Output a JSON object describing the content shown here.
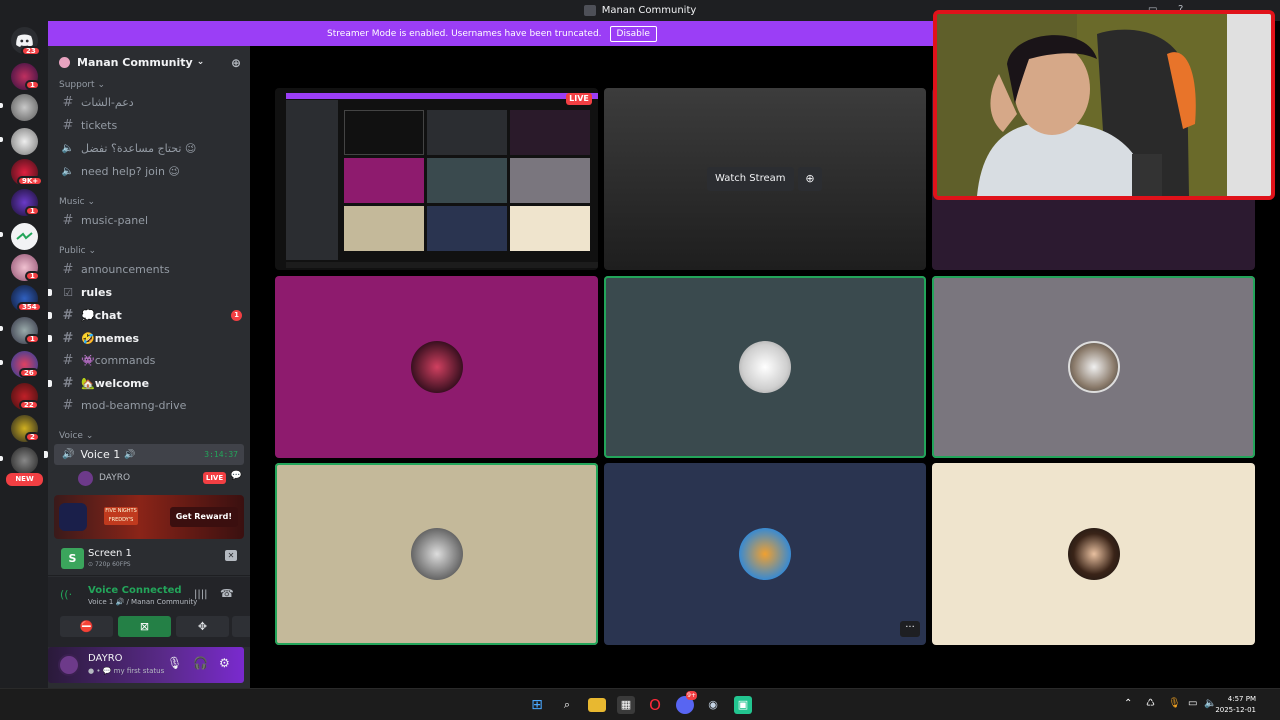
{
  "window": {
    "title": "Manan Community"
  },
  "banner": {
    "text": "Streamer Mode is enabled. Usernames have been truncated.",
    "button": "Disable"
  },
  "guild_badges": {
    "home": "23",
    "b1": "1",
    "b2": "9K+",
    "b3": "1",
    "b4": "1",
    "b5": "354",
    "b6": "1",
    "b7": "26",
    "b8": "22",
    "b9": "2",
    "new": "NEW"
  },
  "server": {
    "name": "Manan Community",
    "chevron": "⌄"
  },
  "categories": {
    "support": "Support",
    "music": "Music",
    "public": "Public",
    "voice": "Voice"
  },
  "channels": {
    "support_ar": "دعم-الشات",
    "tickets": "tickets",
    "need_help_ar": "تحتاج مساعدة؟ تفضل 😉",
    "need_help_en": "need help? join 😉",
    "music_panel": "music-panel",
    "announcements": "announcements",
    "rules": "rules",
    "chat": "💭chat",
    "chat_mentions": "1",
    "memes": "🤣memes",
    "commands": "👾commands",
    "welcome": "🏡welcome",
    "mod": "mod-beamng-drive"
  },
  "voice_channel": {
    "name": "Voice 1",
    "timer": "3:14:37",
    "user": "DAYRO",
    "live": "LIVE"
  },
  "promo": {
    "logo_text": "FIVE NIGHTS FREDDY'S",
    "button": "Get Reward!"
  },
  "screen_share": {
    "title": "Screen 1",
    "quality": "720p 60FPS"
  },
  "voice_status": {
    "title": "Voice Connected",
    "subtitle": "Voice 1 🔊 / Manan Community"
  },
  "user": {
    "name": "DAYRO",
    "status": "my first status"
  },
  "stage": {
    "live": "LIVE",
    "watch_stream": "Watch Stream",
    "more": "···"
  },
  "taskbar": {
    "time": "4:57 PM",
    "date": "2025-12-01",
    "discord_badge": "9+"
  },
  "colors": {
    "blurple": "#5865f2",
    "green": "#23a55a",
    "red": "#f23f43",
    "streamer_purple": "#9b3ef6",
    "cam_border": "#e0121a"
  },
  "icons": [
    "discord-icon",
    "chevron-down-icon",
    "invite-icon",
    "hash-icon",
    "speaker-icon",
    "rules-icon",
    "webcam-icon",
    "screen-share-icon",
    "activity-icon",
    "soundboard-icon",
    "mic-icon",
    "headphones-icon",
    "gear-icon",
    "signal-icon",
    "soundwave-icon",
    "disconnect-icon",
    "close-icon",
    "popout-icon",
    "windows-icon",
    "search-icon",
    "folder-icon",
    "store-icon",
    "opera-icon",
    "steam-icon"
  ]
}
